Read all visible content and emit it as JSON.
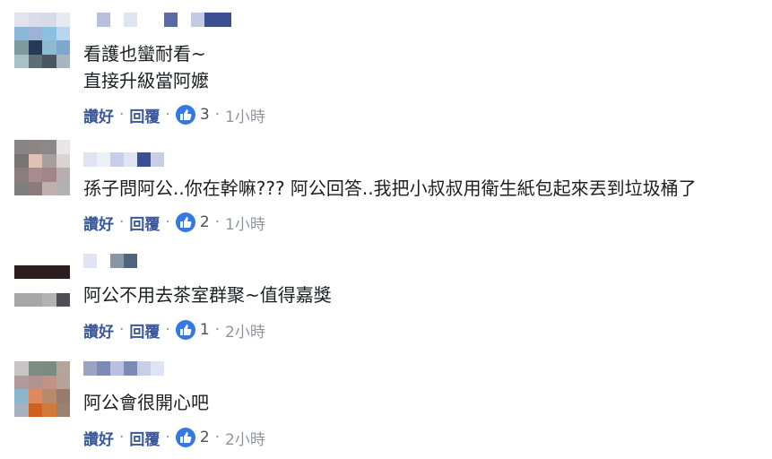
{
  "comments": [
    {
      "text_lines": [
        "看護也蠻耐看~",
        "直接升級當阿嬤"
      ],
      "reply_label": "讚好",
      "reply_action": "回覆",
      "like_count": "3",
      "time": "1小時",
      "avatar_colors": [
        "#e3e3ef",
        "#dadcec",
        "#d8daea",
        "#e7e9f3",
        "#8bb7da",
        "#9ab3d6",
        "#8bc0e3",
        "#b8d6ee",
        "#7c9a9f",
        "#263a55",
        "#8db9d3",
        "#7da7cf",
        "#a8c1c6",
        "#5e6d77",
        "#4b5560",
        "#a9b6bf"
      ],
      "name_colors": [
        "#ffffff",
        "#b8bfdf",
        "#ffffff",
        "#dfe3f2",
        "#ffffff",
        "#ffffff",
        "#5a6aa8",
        "#ffffff",
        "#c4cae6",
        "#3c4f95",
        "#3c4f95",
        "#ffffff"
      ]
    },
    {
      "text_lines": [
        "孫子問阿公..你在幹嘛??? 阿公回答..我把小叔叔用衛生紙包起來丟到垃圾桶了"
      ],
      "reply_label": "讚好",
      "reply_action": "回覆",
      "like_count": "2",
      "time": "1小時",
      "avatar_colors": [
        "#868484",
        "#8c8582",
        "#8b8889",
        "#e8e6e8",
        "#7a7473",
        "#e0c1b4",
        "#a79f9b",
        "#d9d3d3",
        "#8a7d7e",
        "#a98c8e",
        "#a08589",
        "#b8aeb0",
        "#807f7f",
        "#8d7a7c",
        "#bfb0b0",
        "#b4b1b4"
      ],
      "name_colors": [
        "#dfe3f2",
        "#eef0f8",
        "#c8cde8",
        "#dfe3f2",
        "#3c4f95",
        "#c8cde8"
      ]
    },
    {
      "text_lines": [
        "阿公不用去茶室群聚~值得嘉獎"
      ],
      "reply_label": "讚好",
      "reply_action": "回覆",
      "like_count": "1",
      "time": "2小時",
      "avatar_colors": [
        "#ffffff",
        "#ffffff",
        "#ffffff",
        "#ffffff",
        "#2c1e1e",
        "#2c1e1e",
        "#2c1e1e",
        "#2c1e1e",
        "#ffffff",
        "#ffffff",
        "#ffffff",
        "#ffffff",
        "#a8a6a8",
        "#a8a6a8",
        "#b4b2b4",
        "#4d4f54"
      ],
      "name_colors": [
        "#dfe3f2",
        "#ffffff",
        "#8a96a8",
        "#50647b"
      ]
    },
    {
      "text_lines": [
        "阿公會很開心吧"
      ],
      "reply_label": "讚好",
      "reply_action": "回覆",
      "like_count": "2",
      "time": "2小時",
      "avatar_colors": [
        "#c8c6c5",
        "#7e8d83",
        "#7c8a82",
        "#b4a49a",
        "#b29a9a",
        "#b2928f",
        "#c09386",
        "#b6a19b",
        "#8bb6cf",
        "#e0895e",
        "#b58b6e",
        "#9a7a6a",
        "#a8b0bf",
        "#d06020",
        "#d27a3a",
        "#9a8070"
      ],
      "name_colors": [
        "#9aa4c2",
        "#7d8ab5",
        "#b8bfdf",
        "#7d8ab5",
        "#c8cde8",
        "#dfe3f2"
      ]
    }
  ]
}
